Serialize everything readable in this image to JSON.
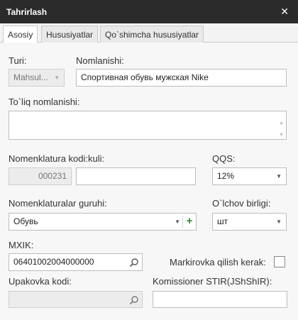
{
  "window": {
    "title": "Tahrirlash",
    "close_glyph": "✕"
  },
  "tabs": [
    {
      "label": "Asosiy"
    },
    {
      "label": "Hususiyatlar"
    },
    {
      "label": "Qo`shimcha hususiyatlar"
    }
  ],
  "form": {
    "type": {
      "label": "Turi:",
      "value": "Mahsul..."
    },
    "name": {
      "label": "Nomlanishi:",
      "value": "Спортивная обувь мужская Nike"
    },
    "full_name": {
      "label": "To`liq nomlanishi:",
      "value": ""
    },
    "code": {
      "label": "Nomenklatura kodi:",
      "code_value": "000231"
    },
    "kuli": {
      "label": "kuli:",
      "value": ""
    },
    "vat": {
      "label": "QQS:",
      "value": "12%"
    },
    "group": {
      "label": "Nomenklaturalar guruhi:",
      "value": "Обувь",
      "add_glyph": "+"
    },
    "unit": {
      "label": "O`lchov birligi:",
      "value": "шт"
    },
    "mxik": {
      "label": "MXIK:",
      "value": "06401002004000000"
    },
    "marking": {
      "label": "Markirovka qilish kerak:"
    },
    "package_code": {
      "label": "Upakovka kodi:",
      "value": ""
    },
    "commissioner": {
      "label": "Komissioner STIR(JShShIR):",
      "value": ""
    }
  },
  "icons": {
    "close": "close-icon",
    "dropdown": "chevron-down-icon",
    "search": "search-icon",
    "add": "plus-icon"
  }
}
